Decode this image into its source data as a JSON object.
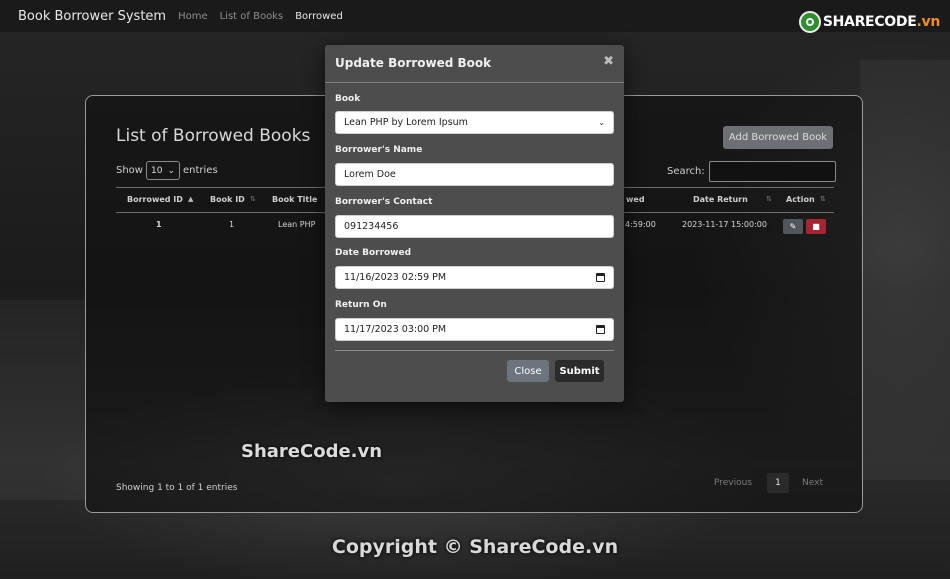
{
  "navbar": {
    "brand": "Book Borrower System",
    "links": [
      {
        "label": "Home"
      },
      {
        "label": "List of Books"
      },
      {
        "label": "Borrowed"
      }
    ],
    "logo": {
      "text_main": "SHARECODE",
      "text_suffix": ".vn"
    }
  },
  "page": {
    "card_title": "List of Borrowed Books",
    "add_button": "Add Borrowed Book",
    "show_label": "Show",
    "entries_value": "10",
    "entries_label": "entries",
    "search_label": "Search:",
    "search_value": "",
    "table": {
      "headers": [
        "Borrowed ID",
        "Book ID",
        "Book Title",
        "wed",
        "Date Return",
        "Action"
      ],
      "rows": [
        {
          "borrowed_id": "1",
          "book_id": "1",
          "book_title": "Lean PHP",
          "date_borrowed": "4:59:00",
          "date_return": "2023-11-17 15:00:00"
        }
      ]
    },
    "info": "Showing 1 to 1 of 1 entries",
    "pagination": {
      "previous": "Previous",
      "current": "1",
      "next": "Next"
    }
  },
  "modal": {
    "title": "Update Borrowed Book",
    "close_icon": "✖",
    "fields": {
      "book": {
        "label": "Book",
        "value": "Lean PHP by Lorem Ipsum"
      },
      "name": {
        "label": "Borrower's Name",
        "value": "Lorem Doe"
      },
      "contact": {
        "label": "Borrower's Contact",
        "value": "091234456"
      },
      "date_borrowed": {
        "label": "Date Borrowed",
        "value": "11/16/2023 02:59 PM"
      },
      "return_on": {
        "label": "Return On",
        "value": "11/17/2023 03:00 PM"
      }
    },
    "close_button": "Close",
    "submit_button": "Submit"
  },
  "watermark": "ShareCode.vn",
  "footer": "Copyright © ShareCode.vn"
}
